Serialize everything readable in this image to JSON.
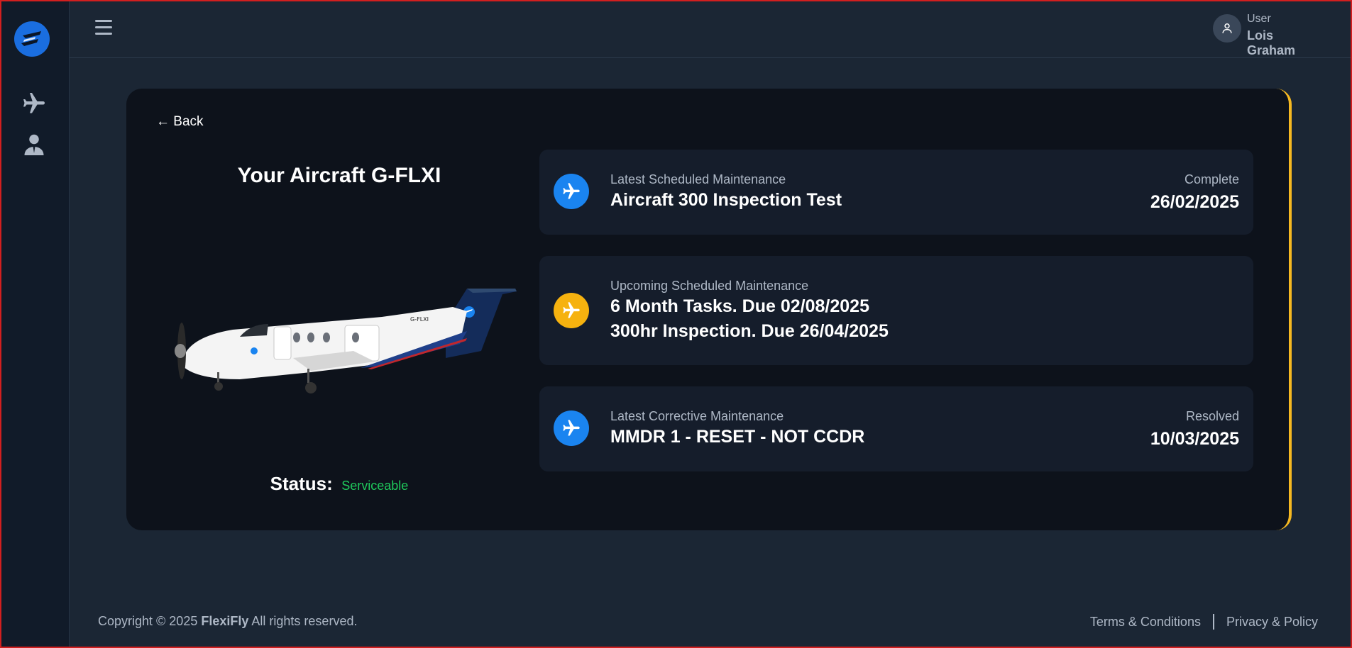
{
  "sidebar": {
    "logo_icon": "flexifly-logo",
    "items": [
      {
        "icon": "airplane-icon"
      },
      {
        "icon": "pilot-icon"
      }
    ]
  },
  "header": {
    "user_role": "User",
    "user_name": "Lois Graham"
  },
  "card": {
    "back_label": "← Back",
    "title": "Your Aircraft G-FLXI",
    "tail_number": "G-FLXI",
    "status_label": "Status:",
    "status_value": "Serviceable"
  },
  "panels": [
    {
      "label": "Latest Scheduled Maintenance",
      "lines": [
        "Aircraft 300 Inspection Test"
      ],
      "right_label": "Complete",
      "right_value": "26/02/2025",
      "icon_color": "#1a84f0"
    },
    {
      "label": "Upcoming Scheduled Maintenance",
      "lines": [
        "6 Month Tasks. Due 02/08/2025",
        "300hr Inspection. Due 26/04/2025"
      ],
      "right_label": "",
      "right_value": "",
      "icon_color": "#f6b20f"
    },
    {
      "label": "Latest Corrective Maintenance",
      "lines": [
        "MMDR 1 - RESET - NOT CCDR"
      ],
      "right_label": "Resolved",
      "right_value": "10/03/2025",
      "icon_color": "#1a84f0"
    }
  ],
  "footer": {
    "copyright_prefix": "Copyright © 2025",
    "brand": "FlexiFly",
    "copyright_suffix": "All rights reserved.",
    "terms": "Terms & Conditions",
    "privacy": "Privacy & Policy"
  },
  "colors": {
    "accent_yellow": "#f5b821",
    "accent_blue": "#1a84f0",
    "status_green": "#1fca5c"
  }
}
